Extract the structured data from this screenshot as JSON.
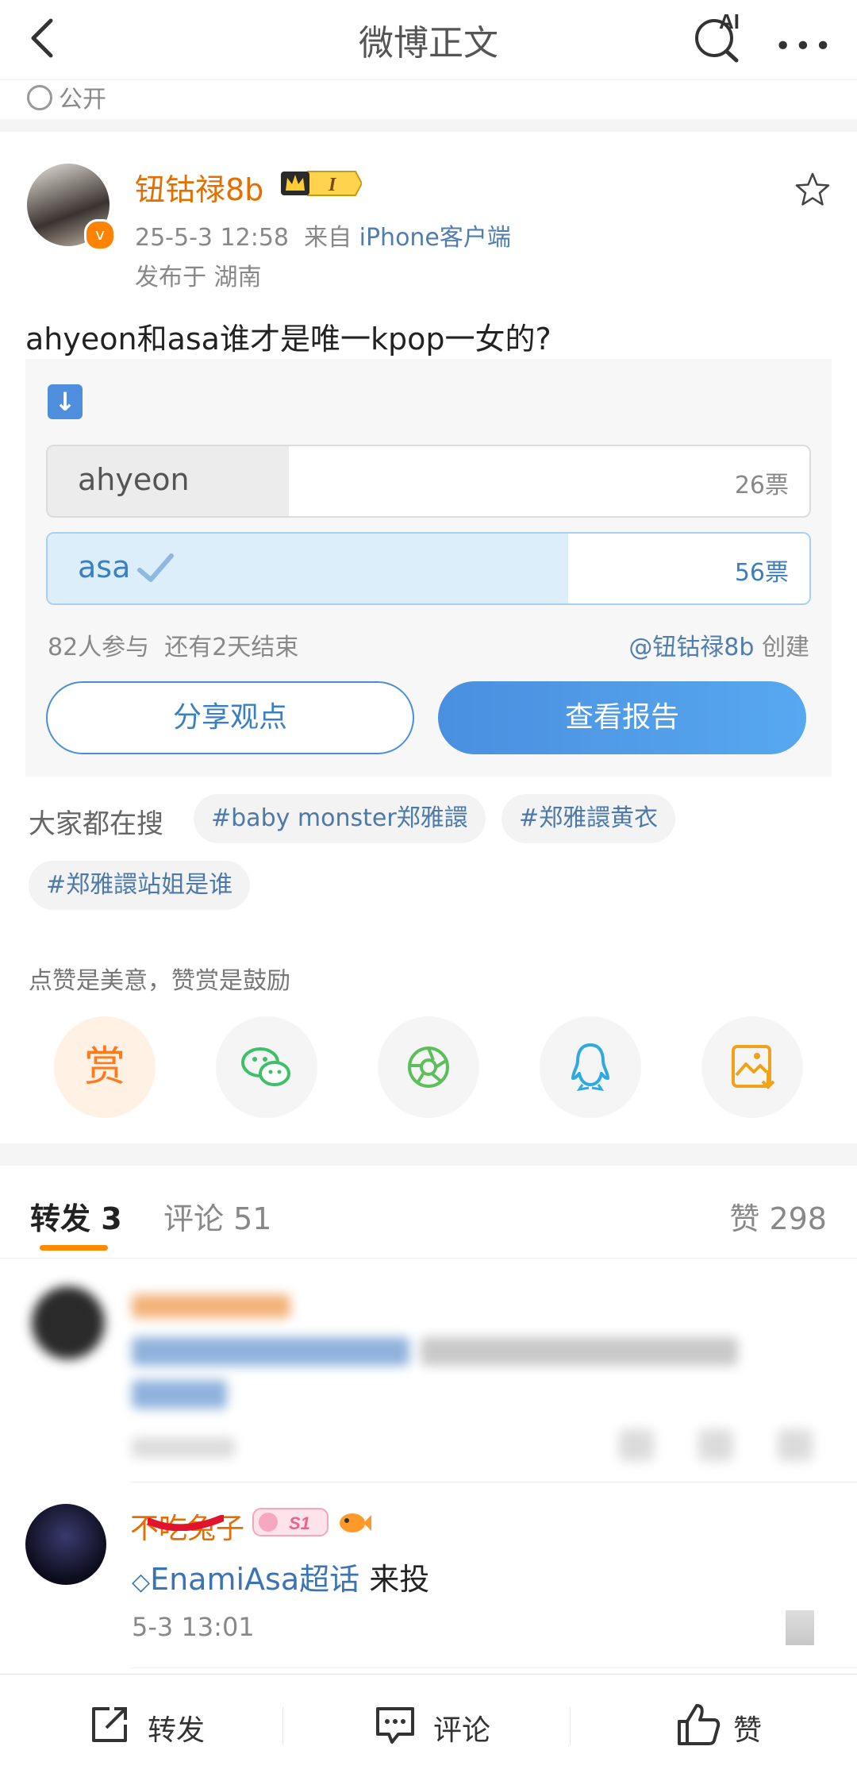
{
  "header": {
    "title": "微博正文",
    "ai_label": "AI"
  },
  "post": {
    "visibility": "公开",
    "author": {
      "name": "钮钴禄8b",
      "level": "I"
    },
    "timestamp": "25-5-3 12:58",
    "source_prefix": "来自",
    "source": "iPhone客户端",
    "location": "发布于 湖南",
    "text": "ahyeon和asa谁才是唯一kpop一女的?"
  },
  "poll": {
    "options": [
      {
        "label": "ahyeon",
        "votes_text": "26票",
        "share": 0.317
      },
      {
        "label": "asa",
        "votes_text": "56票",
        "share": 0.683,
        "selected": true
      }
    ],
    "participants": "82人参与",
    "remaining": "还有2天结束",
    "creator_handle": "@钮钴禄8b",
    "creator_suffix": " 创建",
    "share_button": "分享观点",
    "report_button": "查看报告"
  },
  "trending": {
    "label": "大家都在搜",
    "tags": [
      "#baby monster郑雅譞",
      "#郑雅譞黄衣",
      "#郑雅譞站姐是谁"
    ]
  },
  "like_hint": "点赞是美意，赞赏是鼓励",
  "reward_label": "赏",
  "tabs": {
    "forward": "转发 3",
    "comments": "评论 51",
    "likes": "赞 298"
  },
  "comment": {
    "user": "不吃兔子",
    "badge": "S1",
    "topic": "EnamiAsa超话",
    "text": " 来投",
    "time": "5-3 13:01"
  },
  "bottom_bar": {
    "forward": "转发",
    "comment": "评论",
    "like": "赞"
  },
  "colors": {
    "accent": "#ff8200",
    "link": "#507daf",
    "poll_blue": "#4a8fe0"
  }
}
